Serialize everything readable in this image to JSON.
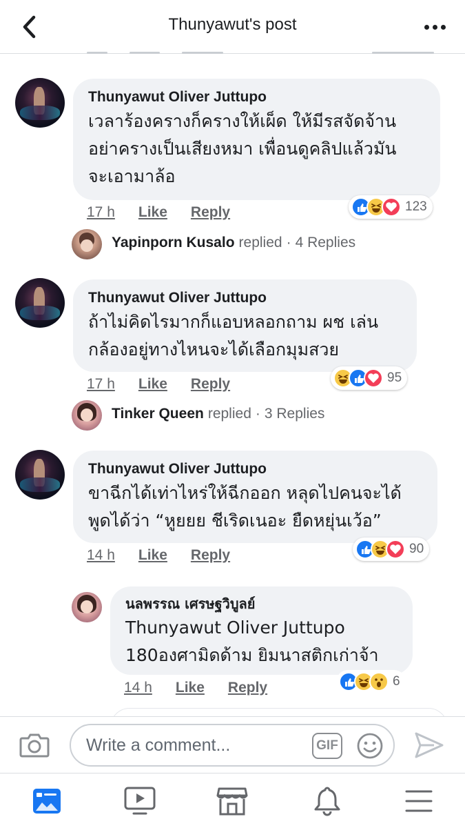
{
  "header": {
    "title": "Thunyawut's post"
  },
  "comments": [
    {
      "author": "Thunyawut Oliver Juttupo",
      "lines": [
        "เวลาร้องครางก็ครางให้เผ็ด ให้มีรสจัดจ้าน",
        "อย่าครางเป็นเสียงหมา เพื่อนดูคลิปแล้วมัน",
        "จะเอามาล้อ"
      ],
      "time": "17 h",
      "like_label": "Like",
      "reply_label": "Reply",
      "reactions": [
        "like",
        "haha",
        "love"
      ],
      "reaction_count": "123",
      "replies": {
        "name": "Yapinporn Kusalo",
        "verb": "replied",
        "count_text": "4 Replies"
      }
    },
    {
      "author": "Thunyawut Oliver Juttupo",
      "lines": [
        "ถ้าไม่คิดไรมากก็แอบหลอกถาม ผช เล่น",
        "กล้องอยู่ทางไหนจะได้เลือกมุมสวย"
      ],
      "time": "17 h",
      "like_label": "Like",
      "reply_label": "Reply",
      "reactions": [
        "haha",
        "like",
        "love"
      ],
      "reaction_count": "95",
      "replies": {
        "name": "Tinker Queen",
        "verb": "replied",
        "count_text": "3 Replies"
      }
    },
    {
      "author": "Thunyawut Oliver Juttupo",
      "lines": [
        "ขาฉีกได้เท่าไหร่ให้ฉีกออก หลุดไปคนจะได้",
        "พูดได้ว่า “หูยยย ชีเริดเนอะ ยืดหยุ่นเว้อ”"
      ],
      "time": "14 h",
      "like_label": "Like",
      "reply_label": "Reply",
      "reactions": [
        "like",
        "haha",
        "love"
      ],
      "reaction_count": "90"
    }
  ],
  "reply": {
    "author": "นลพรรณ เศรษฐวิบูลย์",
    "lines": [
      "Thunyawut Oliver Juttupo",
      "180องศามิดด้าม ยิมนาสติกเก่าจ้า"
    ],
    "time": "14 h",
    "like_label": "Like",
    "reply_label": "Reply",
    "reactions": [
      "like",
      "haha",
      "wow"
    ],
    "reaction_count": "6"
  },
  "composer": {
    "placeholder": "Write a comment...",
    "gif_label": "GIF"
  },
  "tabs": [
    "news-feed",
    "watch",
    "marketplace",
    "notifications",
    "menu"
  ],
  "colors": {
    "accent": "#1877f2",
    "bubble": "#f0f2f5",
    "love": "#f33e58",
    "haha": "#f7c948"
  }
}
